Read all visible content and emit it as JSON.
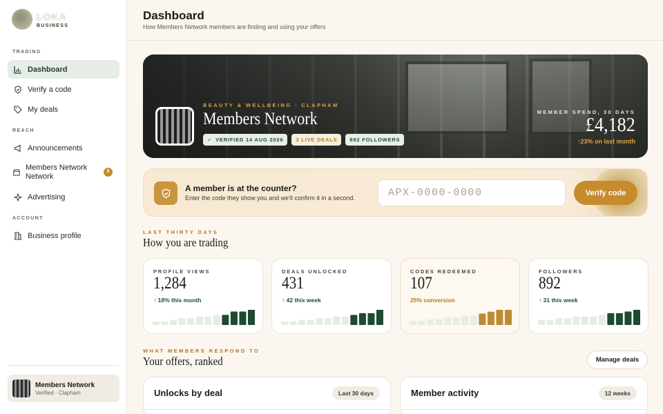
{
  "brand": {
    "name": "LOKA",
    "sub": "BUSINESS"
  },
  "sidebar": {
    "sections": [
      "TRADING",
      "REACH",
      "ACCOUNT"
    ],
    "items": [
      {
        "label": "Dashboard",
        "icon": "bar-chart-icon"
      },
      {
        "label": "Verify a code",
        "icon": "shield-check-icon"
      },
      {
        "label": "My deals",
        "icon": "tag-icon"
      },
      {
        "label": "Announcements",
        "icon": "megaphone-icon"
      },
      {
        "label": "Members Network Network",
        "icon": "store-icon",
        "badge": "3"
      },
      {
        "label": "Advertising",
        "icon": "sparkle-icon"
      },
      {
        "label": "Business profile",
        "icon": "building-icon"
      }
    ],
    "footer": {
      "name": "Members Network",
      "sub": "Verified · Clapham"
    }
  },
  "header": {
    "title": "Dashboard",
    "subtitle": "How Members Network members are finding and using your offers"
  },
  "hero": {
    "kicker": "BEAUTY & WELLBEING · CLAPHAM",
    "name": "Members Network",
    "tags": {
      "verified": "VERIFIED 14 AUG 2026",
      "deals": "3 LIVE DEALS",
      "followers": "892 FOLLOWERS"
    },
    "spend_label": "MEMBER SPEND, 30 DAYS",
    "spend_value": "£4,182",
    "spend_delta": "23% on last month"
  },
  "verify": {
    "title": "A member is at the counter?",
    "subtitle": "Enter the code they show you and we'll confirm it in a second.",
    "placeholder": "APX-0000-0000",
    "button": "Verify code"
  },
  "trading": {
    "kicker": "LAST THIRTY DAYS",
    "title": "How you are trading"
  },
  "stats": [
    {
      "label": "PROFILE VIEWS",
      "value": "1,284",
      "delta": "18% this month",
      "bars": [
        2,
        2,
        3,
        4,
        4,
        5,
        5,
        6,
        6,
        8,
        8,
        9
      ]
    },
    {
      "label": "DEALS UNLOCKED",
      "value": "431",
      "delta": "42 this week",
      "bars": [
        2,
        2,
        3,
        3,
        4,
        4,
        5,
        5,
        6,
        7,
        7,
        9
      ]
    },
    {
      "label": "CODES REDEEMED",
      "value": "107",
      "delta": "25% conversion",
      "bars": [
        2,
        2,
        3,
        3,
        4,
        4,
        5,
        5,
        6,
        7,
        8,
        8
      ]
    },
    {
      "label": "FOLLOWERS",
      "value": "892",
      "delta": "31 this week",
      "bars": [
        3,
        3,
        4,
        4,
        5,
        5,
        5,
        6,
        7,
        7,
        8,
        9
      ]
    }
  ],
  "offers": {
    "kicker": "WHAT MEMBERS RESPOND TO",
    "title": "Your offers, ranked",
    "manage": "Manage deals"
  },
  "panels": [
    {
      "title": "Unlocks by deal",
      "chip": "Last 30 days"
    },
    {
      "title": "Member activity",
      "chip": "12 weeks"
    }
  ],
  "colors": {
    "accent": "#c68b2c",
    "green": "#1e4a32",
    "cream": "#fbf7f0"
  }
}
